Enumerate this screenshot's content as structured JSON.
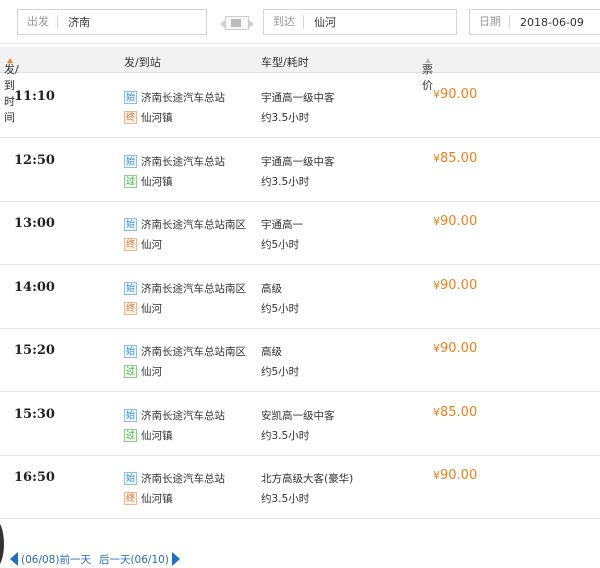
{
  "search": {
    "from_label": "出发",
    "from_value": "济南",
    "to_label": "到达",
    "to_value": "仙河",
    "date_label": "日期",
    "date_value": "2018-06-09"
  },
  "table": {
    "headers": {
      "time": "发/到时间",
      "station": "发/到站",
      "bus": "车型/耗时",
      "price": "票价"
    },
    "rows": [
      {
        "time": "11:10",
        "depart_badge": "始",
        "depart": "济南长途汽车总站",
        "arrive_badge": "终",
        "arrive": "仙河镇",
        "bus": "宇通高一级中客",
        "duration": "约3.5小时",
        "currency": "¥",
        "price": "90.00"
      },
      {
        "time": "12:50",
        "depart_badge": "始",
        "depart": "济南长途汽车总站",
        "arrive_badge": "过",
        "arrive": "仙河镇",
        "bus": "宇通高一级中客",
        "duration": "约3.5小时",
        "currency": "¥",
        "price": "85.00"
      },
      {
        "time": "13:00",
        "depart_badge": "始",
        "depart": "济南长途汽车总站南区",
        "arrive_badge": "终",
        "arrive": "仙河",
        "bus": "宇通高一",
        "duration": "约5小时",
        "currency": "¥",
        "price": "90.00"
      },
      {
        "time": "14:00",
        "depart_badge": "始",
        "depart": "济南长途汽车总站南区",
        "arrive_badge": "终",
        "arrive": "仙河",
        "bus": "高级",
        "duration": "约5小时",
        "currency": "¥",
        "price": "90.00"
      },
      {
        "time": "15:20",
        "depart_badge": "始",
        "depart": "济南长途汽车总站南区",
        "arrive_badge": "过",
        "arrive": "仙河",
        "bus": "高级",
        "duration": "约5小时",
        "currency": "¥",
        "price": "90.00"
      },
      {
        "time": "15:30",
        "depart_badge": "始",
        "depart": "济南长途汽车总站",
        "arrive_badge": "过",
        "arrive": "仙河镇",
        "bus": "安凯高一级中客",
        "duration": "约3.5小时",
        "currency": "¥",
        "price": "85.00"
      },
      {
        "time": "16:50",
        "depart_badge": "始",
        "depart": "济南长途汽车总站",
        "arrive_badge": "终",
        "arrive": "仙河镇",
        "bus": "北方高级大客(豪华)",
        "duration": "约3.5小时",
        "currency": "¥",
        "price": "90.00"
      }
    ]
  },
  "pager": {
    "prev": "(06/08)前一天",
    "next": "后一天(06/10)"
  },
  "colors": {
    "price": "#f07f1a",
    "link": "#2a6db5",
    "sort_active": "#f08a24"
  }
}
